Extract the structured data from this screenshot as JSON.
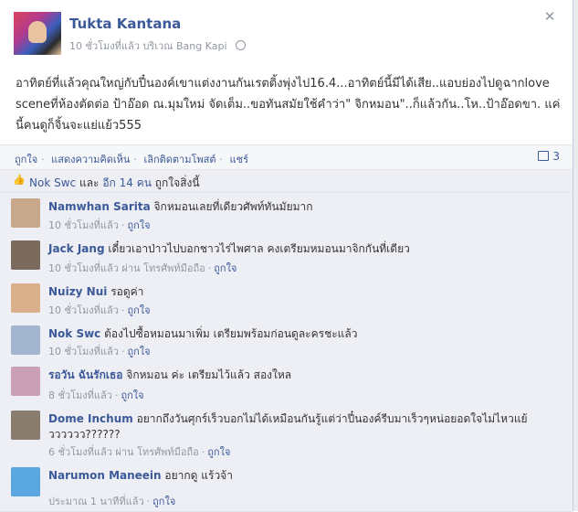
{
  "post": {
    "author": "Tukta Kantana",
    "time": "10 ชั่วโมงที่แล้ว",
    "location": "บริเวณ Bang Kapi",
    "text": "อาทิตย์ที่แล้วคุณใหญ่กับปี๋นองค์เขาแต่งงานกันเรตติ้งพุ่งไป16.4...อาทิตย์นี้มีได้เสีย..แอบย่องไปดูฉากlove sceneที่ห้องตัดต่อ ป้าอ๊อด ณ.มุมใหม่ จัดเต็ม..ขอทันสมัยใช้คำว่า\" จิกหมอน\"..ก็แล้วกัน..โห..ป้าอ๊อดขา. แค่นี้คนดูก็จิ้นจะแย่แย้ว555"
  },
  "actions": {
    "like": "ถูกใจ",
    "comment": "แสดงความคิดเห็น",
    "unfollow": "เลิกติดตามโพสต์",
    "share": "แชร์",
    "comment_count": "3"
  },
  "likes": {
    "first": "Nok Swc",
    "and": "และ",
    "others": "อีก 14 คน",
    "suffix": "ถูกใจสิ่งนี้"
  },
  "like_label": "ถูกใจ",
  "mobile_label": "ผ่าน โทรศัพท์มือถือ",
  "comments": [
    {
      "name": "Namwhan Sarita",
      "text": "จิกหมอนเลยที่เดียวศัพท์ทันมัยมาก",
      "time": "10 ชั่วโมงที่แล้ว",
      "mobile": false,
      "color": "#c7a88a"
    },
    {
      "name": "Jack Jang",
      "text": "เดี๋ยวเอาป่าวไปบอกชาวไร่ไพศาล คงเตรียมหมอนมาจิกกันที่เดียว",
      "time": "10 ชั่วโมงที่แล้ว",
      "mobile": true,
      "color": "#7a6a5c"
    },
    {
      "name": "Nuizy Nui",
      "text": "รอดูค่า",
      "time": "10 ชั่วโมงที่แล้ว",
      "mobile": false,
      "color": "#d9b08c"
    },
    {
      "name": "Nok Swc",
      "text": "ต้องไปซื้อหมอนมาเพิ่ม เตรียมพร้อมก่อนดูละครชะแล้ว",
      "time": "10 ชั่วโมงที่แล้ว",
      "mobile": false,
      "color": "#a3b6cf"
    },
    {
      "name": "รอวัน ฉันรักเธอ",
      "text": "จิกหมอน ค่ะ เตรียมไว้แล้ว สองใหล",
      "time": "8 ชั่วโมงที่แล้ว",
      "mobile": false,
      "color": "#c9a0b5"
    },
    {
      "name": "Dome Inchum",
      "text": "อยากถึงวันศุกร์เร็วบอกไม่ได้เหมือนกันรู้แต่ว่าปี๋นองค์รีบมาเร็วๆหน่อยอดใจไม่ไหวแย้วววววว??????",
      "time": "6 ชั่วโมงที่แล้ว",
      "mobile": true,
      "color": "#8a7d70"
    },
    {
      "name": "Narumon Maneein",
      "text": "อยากดู แร้วจ้า",
      "time": "ประมาณ 1 นาทีที่แล้ว",
      "mobile": false,
      "color": "#5aa6e0"
    }
  ]
}
